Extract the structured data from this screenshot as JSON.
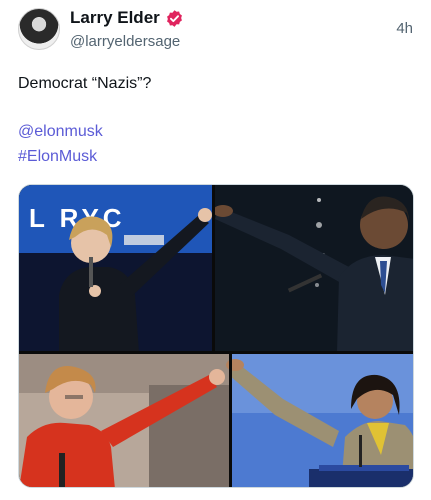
{
  "post": {
    "author_name": "Larry Elder",
    "author_handle": "@larryeldersage",
    "timestamp": "4h",
    "text_line": "Democrat “Nazis”?",
    "mention": "@elonmusk",
    "hashtag": "#ElonMusk"
  },
  "media": {
    "banner_text": "L  RYC"
  },
  "colors": {
    "link": "#5b5bd6",
    "verified_badge": "#e0245e",
    "muted": "#536471"
  },
  "icons": {
    "verified": "verified-badge-icon"
  }
}
